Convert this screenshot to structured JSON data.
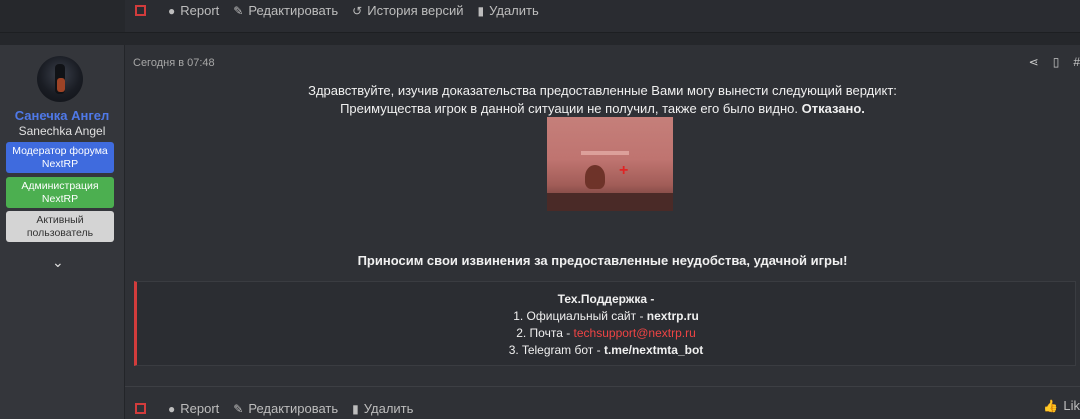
{
  "top_actions": {
    "report": "Report",
    "edit": "Редактировать",
    "history": "История версий",
    "delete": "Удалить"
  },
  "user": {
    "name": "Санечка Ангел",
    "title": "Sanechka Angel",
    "banners": [
      "Модератор форума NextRP",
      "Администрация NextRP",
      "Активный пользователь"
    ]
  },
  "post": {
    "date": "Сегодня в 07:48",
    "line1": "Здравствуйте, изучив доказательства предоставленные Вами могу вынести следующий вердикт:",
    "line2": "Преимущества игрок в данной ситуации не получил, также его было видно.",
    "verdict": "Отказано.",
    "apology": "Приносим свои извинения за предоставленные неудобства, удачной игры!",
    "support": {
      "title": "Тех.Поддержка -",
      "item1_label": "1. Официальный сайт -",
      "item1_value": "nextrp.ru",
      "item2_label": "2. Почта -",
      "item2_value": "techsupport@nextrp.ru",
      "item3_label": "3. Telegram бот -",
      "item3_value": "t.me/nextmta_bot"
    }
  },
  "bottom_actions": {
    "report": "Report",
    "edit": "Редактировать",
    "delete": "Удалить",
    "like": "Lik"
  },
  "colors": {
    "accent_red": "#d23c3c",
    "username_blue": "#4f79e8",
    "banner_moderator": "#3f6bde",
    "banner_admin": "#4caf50",
    "banner_active": "#d4d4d4"
  }
}
